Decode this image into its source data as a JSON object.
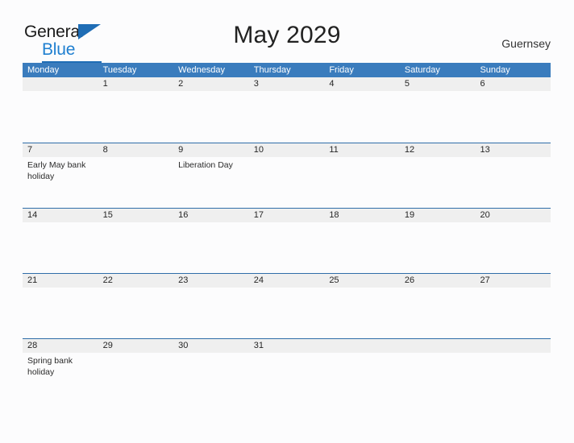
{
  "brand": {
    "name_part1": "General",
    "name_part2": "Blue",
    "flag_icon": "blue-triangle-flag",
    "color_dark": "#1a1a1a",
    "color_blue": "#1f7fd0",
    "color_flag": "#1f6db5"
  },
  "header": {
    "title": "May 2029",
    "region": "Guernsey"
  },
  "calendar": {
    "accent_color": "#3a7cbd",
    "band_color": "#efefef",
    "rule_color": "#2f6da8",
    "weekdays": [
      "Monday",
      "Tuesday",
      "Wednesday",
      "Thursday",
      "Friday",
      "Saturday",
      "Sunday"
    ],
    "weeks": [
      {
        "days": [
          {
            "num": "",
            "events": []
          },
          {
            "num": "1",
            "events": []
          },
          {
            "num": "2",
            "events": []
          },
          {
            "num": "3",
            "events": []
          },
          {
            "num": "4",
            "events": []
          },
          {
            "num": "5",
            "events": []
          },
          {
            "num": "6",
            "events": []
          }
        ]
      },
      {
        "days": [
          {
            "num": "7",
            "events": [
              "Early May bank holiday"
            ]
          },
          {
            "num": "8",
            "events": []
          },
          {
            "num": "9",
            "events": [
              "Liberation Day"
            ]
          },
          {
            "num": "10",
            "events": []
          },
          {
            "num": "11",
            "events": []
          },
          {
            "num": "12",
            "events": []
          },
          {
            "num": "13",
            "events": []
          }
        ]
      },
      {
        "days": [
          {
            "num": "14",
            "events": []
          },
          {
            "num": "15",
            "events": []
          },
          {
            "num": "16",
            "events": []
          },
          {
            "num": "17",
            "events": []
          },
          {
            "num": "18",
            "events": []
          },
          {
            "num": "19",
            "events": []
          },
          {
            "num": "20",
            "events": []
          }
        ]
      },
      {
        "days": [
          {
            "num": "21",
            "events": []
          },
          {
            "num": "22",
            "events": []
          },
          {
            "num": "23",
            "events": []
          },
          {
            "num": "24",
            "events": []
          },
          {
            "num": "25",
            "events": []
          },
          {
            "num": "26",
            "events": []
          },
          {
            "num": "27",
            "events": []
          }
        ]
      },
      {
        "days": [
          {
            "num": "28",
            "events": [
              "Spring bank holiday"
            ]
          },
          {
            "num": "29",
            "events": []
          },
          {
            "num": "30",
            "events": []
          },
          {
            "num": "31",
            "events": []
          },
          {
            "num": "",
            "events": []
          },
          {
            "num": "",
            "events": []
          },
          {
            "num": "",
            "events": []
          }
        ]
      }
    ]
  }
}
